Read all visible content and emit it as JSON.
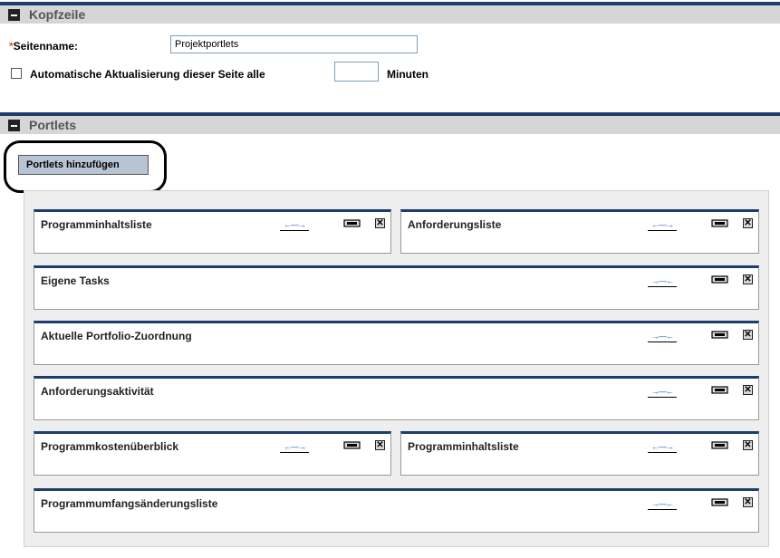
{
  "header_section": {
    "title": "Kopfzeile",
    "required_marker": "*",
    "page_name_label": "Seitenname:",
    "page_name_value": "Projektportlets",
    "auto_refresh_label": "Automatische Aktualisierung dieser Seite alle",
    "auto_refresh_value": "",
    "auto_refresh_unit": "Minuten",
    "auto_refresh_checked": false
  },
  "portlets_section": {
    "title": "Portlets",
    "add_button_label": "Portlets hinzufügen"
  },
  "icons": {
    "expand": "←—→",
    "collapse": "→—←",
    "close": "✕"
  },
  "portlets": [
    {
      "title": "Programminhaltsliste",
      "width_mode": "half",
      "arrow": "expand"
    },
    {
      "title": "Anforderungsliste",
      "width_mode": "half",
      "arrow": "expand"
    },
    {
      "title": "Eigene Tasks",
      "width_mode": "full",
      "arrow": "collapse"
    },
    {
      "title": "Aktuelle Portfolio-Zuordnung",
      "width_mode": "full",
      "arrow": "collapse"
    },
    {
      "title": "Anforderungsaktivität",
      "width_mode": "full",
      "arrow": "collapse"
    },
    {
      "title": "Programmkostenüberblick",
      "width_mode": "half",
      "arrow": "expand"
    },
    {
      "title": "Programminhaltsliste",
      "width_mode": "half",
      "arrow": "expand"
    },
    {
      "title": "Programmumfangsänderungsliste",
      "width_mode": "full",
      "arrow": "collapse"
    }
  ],
  "colors": {
    "header_bar": "#1f3c6e",
    "section_bg": "#d6d6d6",
    "button_bg": "#b7c4d4",
    "required": "#e06000",
    "arrow": "#2b54a8"
  }
}
